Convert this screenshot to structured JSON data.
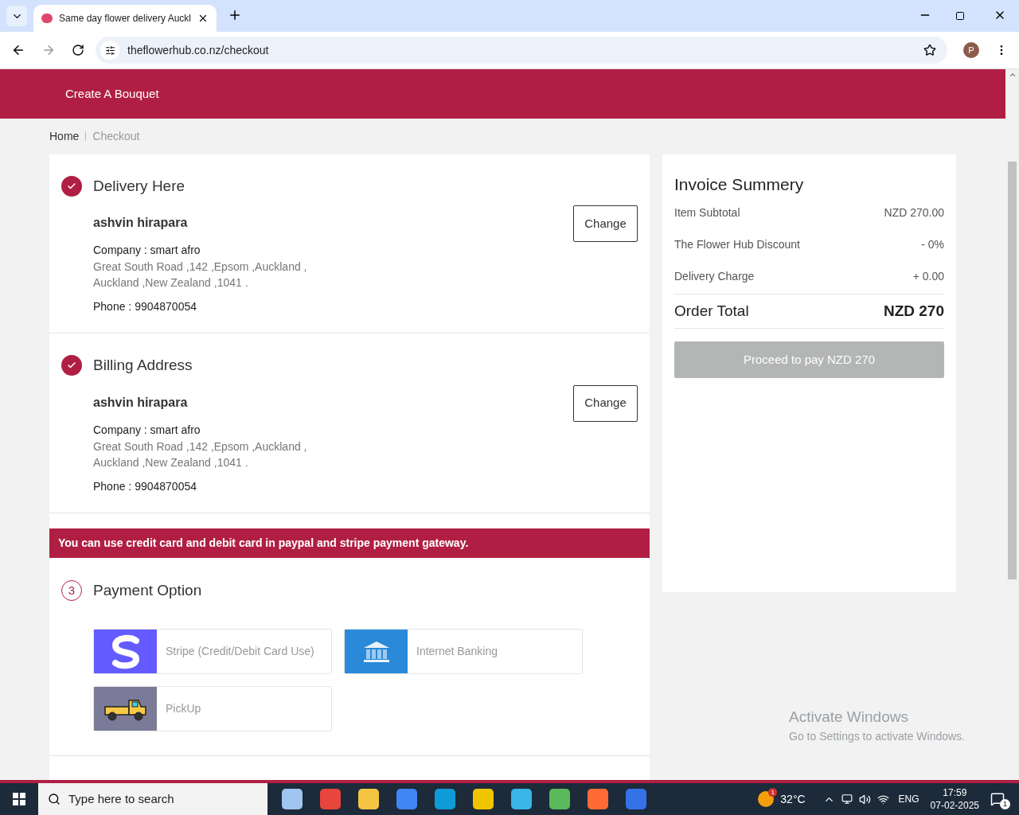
{
  "browser": {
    "tab_title": "Same day flower delivery Auckl",
    "url": "theflowerhub.co.nz/checkout",
    "profile_initial": "P"
  },
  "header": {
    "nav_link": "Create A Bouquet"
  },
  "breadcrumb": [
    {
      "label": "Home",
      "current": false
    },
    {
      "label": "Checkout",
      "current": true
    }
  ],
  "sections": [
    {
      "title": "Delivery Here",
      "completed": true,
      "name": "ashvin hirapara",
      "company": "Company : smart afro",
      "address_lines": [
        "Great South Road ,142 ,Epsom ,Auckland ,",
        "Auckland ,New Zealand ,1041 ."
      ],
      "phone": "Phone : 9904870054",
      "button": "Change"
    },
    {
      "title": "Billing Address",
      "completed": true,
      "name": "ashvin hirapara",
      "company": "Company : smart afro",
      "address_lines": [
        "Great South Road ,142 ,Epsom ,Auckland ,",
        "Auckland ,New Zealand ,1041 ."
      ],
      "phone": "Phone : 9904870054",
      "button": "Change"
    }
  ],
  "notice": "You can use credit card and debit card in paypal and stripe payment gateway.",
  "payment": {
    "title": "Payment Option",
    "completed": false,
    "step": "3",
    "options": [
      {
        "kind": "stripe",
        "label": "Stripe (Credit/Debit Card Use)"
      },
      {
        "kind": "bank",
        "label": "Internet Banking"
      },
      {
        "kind": "pickup",
        "label": "PickUp"
      }
    ]
  },
  "invoice": {
    "title": "Invoice Summery",
    "rows": [
      {
        "label": "Item Subtotal",
        "value": "NZD 270.00"
      },
      {
        "label": "The Flower Hub Discount",
        "value": "- 0%"
      },
      {
        "label": "Delivery Charge",
        "value": "+ 0.00"
      }
    ],
    "total_label": "Order Total",
    "total_value": "NZD 270",
    "button": "Proceed to pay NZD 270",
    "button_disabled": true
  },
  "windows_notice": {
    "title": "Activate Windows",
    "text": "Go to Settings to activate Windows."
  },
  "taskbar": {
    "search_placeholder": "Type here to search",
    "weather_badge": "1",
    "temperature": "32°C",
    "language": "ENG",
    "time": "17:59",
    "date": "07-02-2025",
    "notifications": "1"
  }
}
